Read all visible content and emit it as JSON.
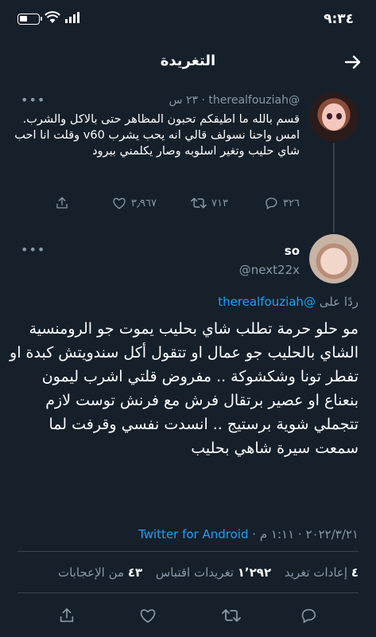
{
  "status_bar": {
    "time": "٩:٣٤"
  },
  "header": {
    "title": "التغريدة"
  },
  "tweet_parent": {
    "display_name": "",
    "handle": "@therealfouziah",
    "time_ago": "٢٣ س",
    "text": "قسم بالله ما اطيقكم تحبون المظاهر حتى بالاكل والشرب. امس واحنا نسولف قالي انه يحب يشرب v60 وقلت انا احب شاي حليب وتغير اسلوبه وصار يكلمني ببرود",
    "replies": "٣٢٦",
    "retweets": "٧١٣",
    "likes": "٣٫٩٦٧"
  },
  "tweet_main": {
    "display_name": "so",
    "handle": "@next22x",
    "reply_prefix": "ردًا على",
    "reply_mention": "@therealfouziah",
    "text": "مو حلو حرمة تطلب شاي بحليب يموت جو الرومنسية الشاي بالحليب جو عمال او تتقول أكل سندويتش كبدة او تفطر تونا وشكشوكة .. مفروض قلتي اشرب ليمون بنعناع او عصير برتقال فرش مع فرنش توست لازم تتجملي شوية برستيج ..  انسدت نفسي وقرفت لما سمعت سيرة شاهي بحليب",
    "date": "٢٠٢٢/٣/٢١",
    "time": "١:١١ م",
    "separator": "·",
    "source": "Twitter for Android",
    "retweets_count": "٤",
    "retweets_label": "إعادات تغريد",
    "quotes_count": "١٬٢٩٢",
    "quotes_label": "تغريدات اقتباس",
    "likes_count": "٤٣",
    "likes_label": "من الإعجابات"
  },
  "icons": [
    "back-arrow-icon",
    "more-icon",
    "reply-icon",
    "retweet-icon",
    "like-icon",
    "share-icon"
  ],
  "colors": {
    "background": "#15202b",
    "accent": "#1da1f2",
    "muted": "#8899a6",
    "divider": "#38444d"
  }
}
